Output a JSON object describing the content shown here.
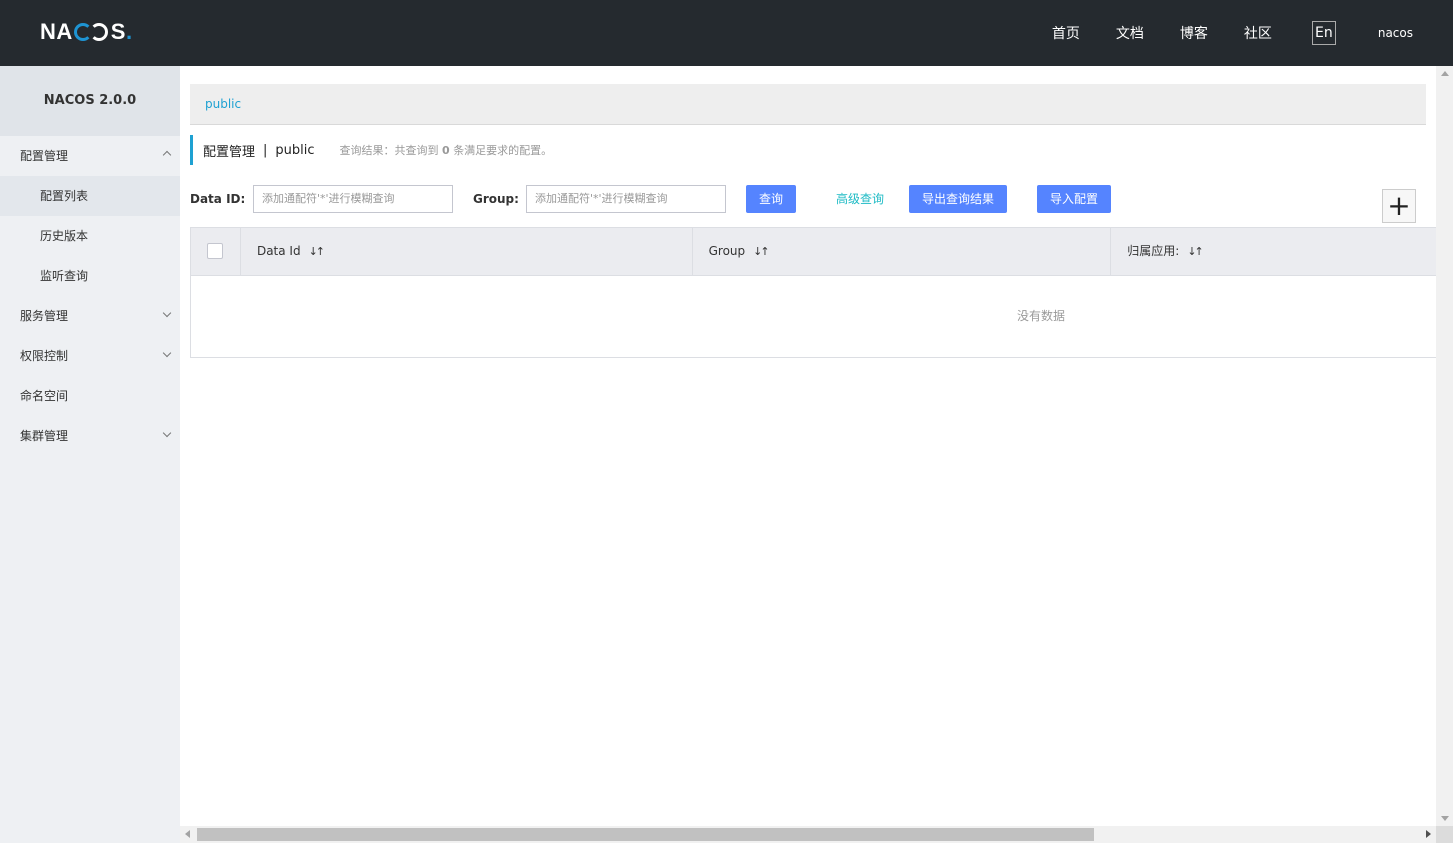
{
  "header": {
    "logo": {
      "left": "NA",
      "right": "S",
      "dot": "."
    },
    "nav": [
      "首页",
      "文档",
      "博客",
      "社区"
    ],
    "lang": "En",
    "user": "nacos"
  },
  "sidebar": {
    "title": "NACOS 2.0.0",
    "items": [
      {
        "label": "配置管理"
      },
      {
        "label": "配置列表"
      },
      {
        "label": "历史版本"
      },
      {
        "label": "监听查询"
      },
      {
        "label": "服务管理"
      },
      {
        "label": "权限控制"
      },
      {
        "label": "命名空间"
      },
      {
        "label": "集群管理"
      }
    ]
  },
  "main": {
    "namespace": "public",
    "title": "配置管理",
    "title_sep": "|",
    "title_ns": "public",
    "result_prefix": "查询结果：共查询到",
    "result_count": "0",
    "result_suffix": "条满足要求的配置。",
    "search": {
      "dataid_label": "Data ID:",
      "dataid_placeholder": "添加通配符'*'进行模糊查询",
      "group_label": "Group:",
      "group_placeholder": "添加通配符'*'进行模糊查询",
      "query_btn": "查询",
      "advanced_link": "高级查询",
      "export_btn": "导出查询结果",
      "import_btn": "导入配置",
      "add_btn": "+"
    },
    "table": {
      "columns": [
        "Data Id",
        "Group",
        "归属应用:"
      ],
      "empty_text": "没有数据"
    }
  },
  "colors": {
    "header_bg": "#252a2f",
    "accent": "#1ea1d2",
    "primary_btn": "#5584ff",
    "sidebar_bg": "#eef0f3"
  }
}
